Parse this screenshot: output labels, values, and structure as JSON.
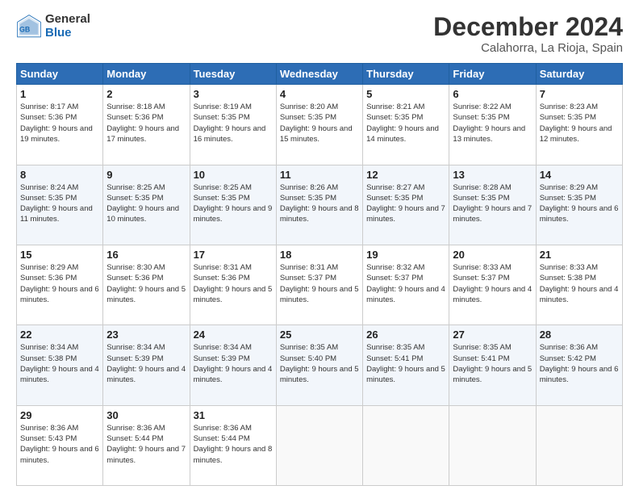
{
  "header": {
    "logo_line1": "General",
    "logo_line2": "Blue",
    "title": "December 2024",
    "subtitle": "Calahorra, La Rioja, Spain"
  },
  "days_of_week": [
    "Sunday",
    "Monday",
    "Tuesday",
    "Wednesday",
    "Thursday",
    "Friday",
    "Saturday"
  ],
  "weeks": [
    [
      {
        "day": 1,
        "sunrise": "8:17 AM",
        "sunset": "5:36 PM",
        "daylight": "9 hours and 19 minutes"
      },
      {
        "day": 2,
        "sunrise": "8:18 AM",
        "sunset": "5:36 PM",
        "daylight": "9 hours and 17 minutes"
      },
      {
        "day": 3,
        "sunrise": "8:19 AM",
        "sunset": "5:35 PM",
        "daylight": "9 hours and 16 minutes"
      },
      {
        "day": 4,
        "sunrise": "8:20 AM",
        "sunset": "5:35 PM",
        "daylight": "9 hours and 15 minutes"
      },
      {
        "day": 5,
        "sunrise": "8:21 AM",
        "sunset": "5:35 PM",
        "daylight": "9 hours and 14 minutes"
      },
      {
        "day": 6,
        "sunrise": "8:22 AM",
        "sunset": "5:35 PM",
        "daylight": "9 hours and 13 minutes"
      },
      {
        "day": 7,
        "sunrise": "8:23 AM",
        "sunset": "5:35 PM",
        "daylight": "9 hours and 12 minutes"
      }
    ],
    [
      {
        "day": 8,
        "sunrise": "8:24 AM",
        "sunset": "5:35 PM",
        "daylight": "9 hours and 11 minutes"
      },
      {
        "day": 9,
        "sunrise": "8:25 AM",
        "sunset": "5:35 PM",
        "daylight": "9 hours and 10 minutes"
      },
      {
        "day": 10,
        "sunrise": "8:25 AM",
        "sunset": "5:35 PM",
        "daylight": "9 hours and 9 minutes"
      },
      {
        "day": 11,
        "sunrise": "8:26 AM",
        "sunset": "5:35 PM",
        "daylight": "9 hours and 8 minutes"
      },
      {
        "day": 12,
        "sunrise": "8:27 AM",
        "sunset": "5:35 PM",
        "daylight": "9 hours and 7 minutes"
      },
      {
        "day": 13,
        "sunrise": "8:28 AM",
        "sunset": "5:35 PM",
        "daylight": "9 hours and 7 minutes"
      },
      {
        "day": 14,
        "sunrise": "8:29 AM",
        "sunset": "5:35 PM",
        "daylight": "9 hours and 6 minutes"
      }
    ],
    [
      {
        "day": 15,
        "sunrise": "8:29 AM",
        "sunset": "5:36 PM",
        "daylight": "9 hours and 6 minutes"
      },
      {
        "day": 16,
        "sunrise": "8:30 AM",
        "sunset": "5:36 PM",
        "daylight": "9 hours and 5 minutes"
      },
      {
        "day": 17,
        "sunrise": "8:31 AM",
        "sunset": "5:36 PM",
        "daylight": "9 hours and 5 minutes"
      },
      {
        "day": 18,
        "sunrise": "8:31 AM",
        "sunset": "5:37 PM",
        "daylight": "9 hours and 5 minutes"
      },
      {
        "day": 19,
        "sunrise": "8:32 AM",
        "sunset": "5:37 PM",
        "daylight": "9 hours and 4 minutes"
      },
      {
        "day": 20,
        "sunrise": "8:33 AM",
        "sunset": "5:37 PM",
        "daylight": "9 hours and 4 minutes"
      },
      {
        "day": 21,
        "sunrise": "8:33 AM",
        "sunset": "5:38 PM",
        "daylight": "9 hours and 4 minutes"
      }
    ],
    [
      {
        "day": 22,
        "sunrise": "8:34 AM",
        "sunset": "5:38 PM",
        "daylight": "9 hours and 4 minutes"
      },
      {
        "day": 23,
        "sunrise": "8:34 AM",
        "sunset": "5:39 PM",
        "daylight": "9 hours and 4 minutes"
      },
      {
        "day": 24,
        "sunrise": "8:34 AM",
        "sunset": "5:39 PM",
        "daylight": "9 hours and 4 minutes"
      },
      {
        "day": 25,
        "sunrise": "8:35 AM",
        "sunset": "5:40 PM",
        "daylight": "9 hours and 5 minutes"
      },
      {
        "day": 26,
        "sunrise": "8:35 AM",
        "sunset": "5:41 PM",
        "daylight": "9 hours and 5 minutes"
      },
      {
        "day": 27,
        "sunrise": "8:35 AM",
        "sunset": "5:41 PM",
        "daylight": "9 hours and 5 minutes"
      },
      {
        "day": 28,
        "sunrise": "8:36 AM",
        "sunset": "5:42 PM",
        "daylight": "9 hours and 6 minutes"
      }
    ],
    [
      {
        "day": 29,
        "sunrise": "8:36 AM",
        "sunset": "5:43 PM",
        "daylight": "9 hours and 6 minutes"
      },
      {
        "day": 30,
        "sunrise": "8:36 AM",
        "sunset": "5:44 PM",
        "daylight": "9 hours and 7 minutes"
      },
      {
        "day": 31,
        "sunrise": "8:36 AM",
        "sunset": "5:44 PM",
        "daylight": "9 hours and 8 minutes"
      },
      null,
      null,
      null,
      null
    ]
  ]
}
